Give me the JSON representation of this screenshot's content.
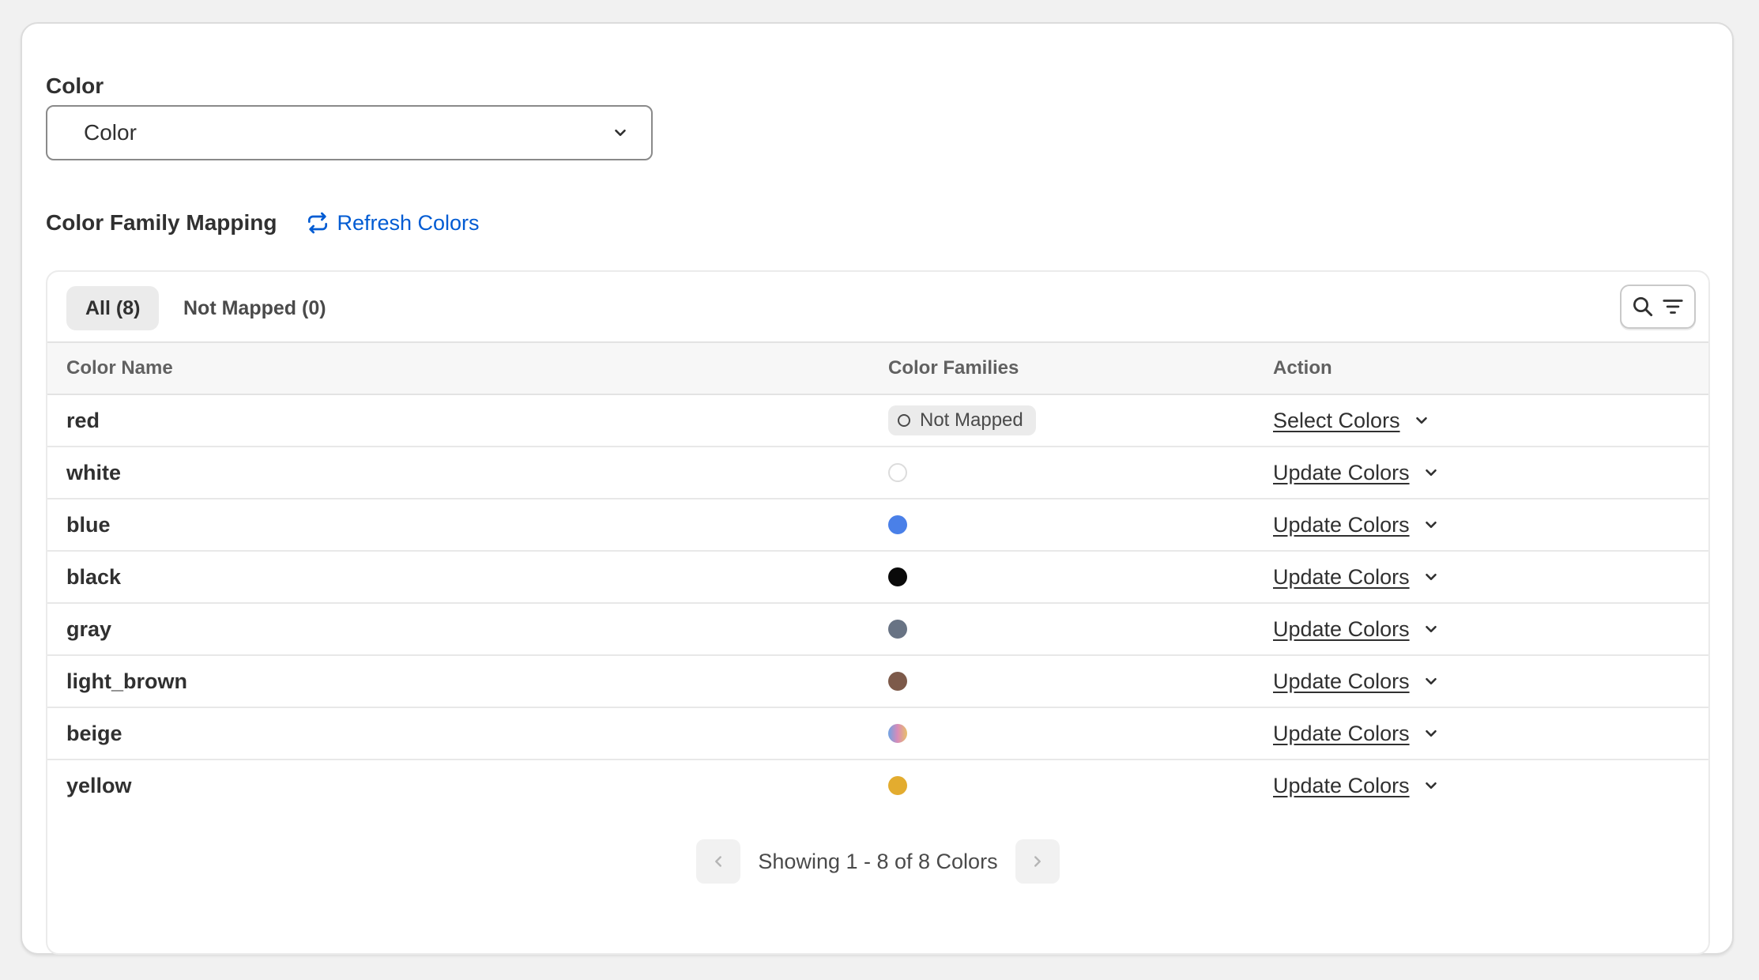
{
  "color_section": {
    "title": "Color",
    "select_value": "Color"
  },
  "mapping": {
    "title": "Color Family Mapping",
    "refresh_label": "Refresh Colors"
  },
  "tabs": [
    {
      "label": "All (8)",
      "active": true
    },
    {
      "label": "Not Mapped (0)",
      "active": false
    }
  ],
  "table": {
    "headers": [
      "Color Name",
      "Color Families",
      "Action"
    ],
    "rows": [
      {
        "name": "red",
        "family": "Not Mapped",
        "family_type": "badge",
        "action": "Select Colors"
      },
      {
        "name": "white",
        "family_type": "swatch",
        "swatch": "#ffffff",
        "action": "Update Colors"
      },
      {
        "name": "blue",
        "family_type": "swatch",
        "swatch": "#4a80e8",
        "action": "Update Colors"
      },
      {
        "name": "black",
        "family_type": "swatch",
        "swatch": "#0a0a0a",
        "action": "Update Colors"
      },
      {
        "name": "gray",
        "family_type": "swatch",
        "swatch": "#687384",
        "action": "Update Colors"
      },
      {
        "name": "light_brown",
        "family_type": "swatch",
        "swatch": "#7d5a4a",
        "action": "Update Colors"
      },
      {
        "name": "beige",
        "family_type": "swatch",
        "swatch": "multicolor",
        "action": "Update Colors"
      },
      {
        "name": "yellow",
        "family_type": "swatch",
        "swatch": "#e3ac2f",
        "action": "Update Colors"
      }
    ]
  },
  "pagination": {
    "text": "Showing 1 - 8 of 8 Colors"
  },
  "icons": {
    "select_chevron": "chevron-down-icon",
    "refresh": "refresh-icon",
    "search": "search-icon",
    "filter": "filter-icon",
    "prev": "chevron-left-icon",
    "next": "chevron-right-icon"
  },
  "colors": {
    "accent_link": "#005bd3",
    "card_bg": "#ffffff",
    "page_bg": "#f1f1f1"
  }
}
